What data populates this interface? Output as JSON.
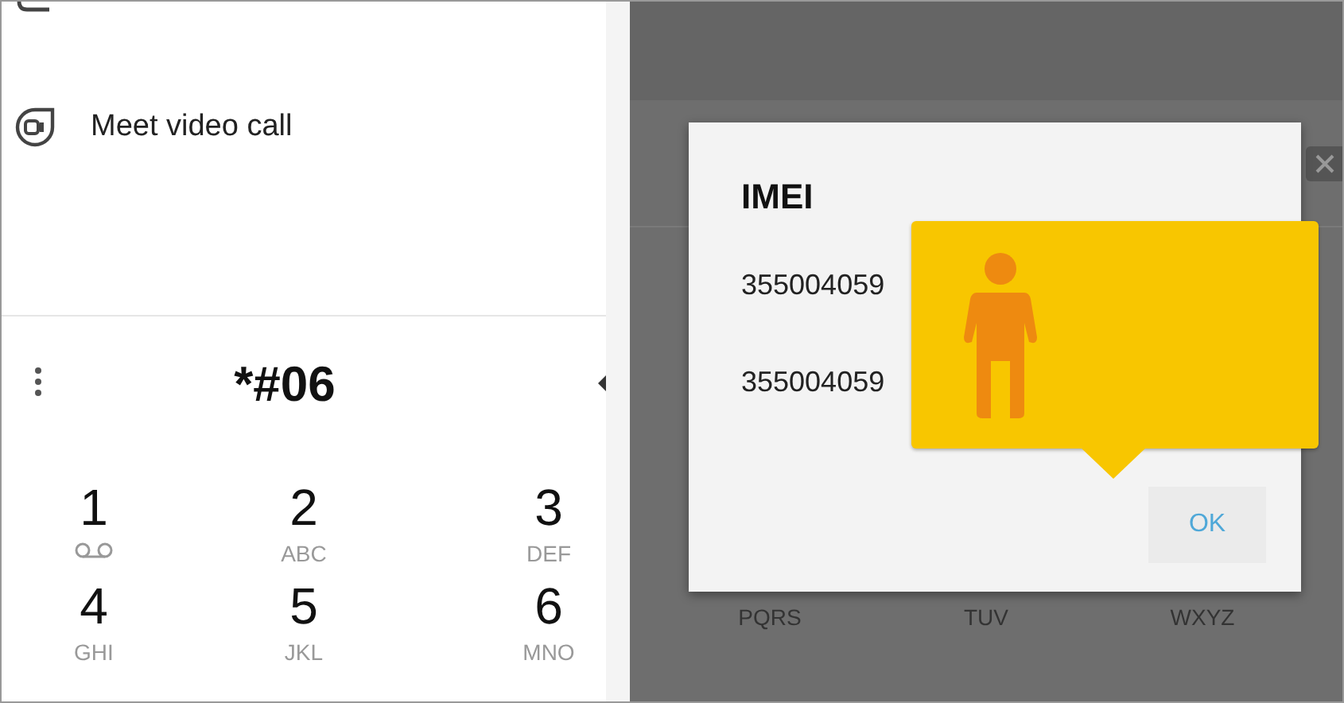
{
  "dialer": {
    "actions": [
      {
        "kind": "sms"
      },
      {
        "label": "Meet video call",
        "kind": "video"
      }
    ],
    "dialed": "*#06",
    "keys": [
      {
        "digit": "1",
        "kind": "voicemail"
      },
      {
        "digit": "2",
        "letters": "ABC",
        "kind": "letters"
      },
      {
        "digit": "3",
        "letters": "DEF",
        "kind": "letters"
      },
      {
        "digit": "4",
        "letters": "GHI",
        "kind": "letters"
      },
      {
        "digit": "5",
        "letters": "JKL",
        "kind": "letters"
      },
      {
        "digit": "6",
        "letters": "MNO",
        "kind": "letters"
      }
    ]
  },
  "imei_screen": {
    "keys_behind": [
      {
        "letters": "PQRS"
      },
      {
        "letters": "TUV"
      },
      {
        "letters": "WXYZ"
      }
    ],
    "dialog": {
      "title": "IMEI",
      "numbers": [
        "355004059",
        "355004059"
      ],
      "ok": "OK"
    }
  }
}
